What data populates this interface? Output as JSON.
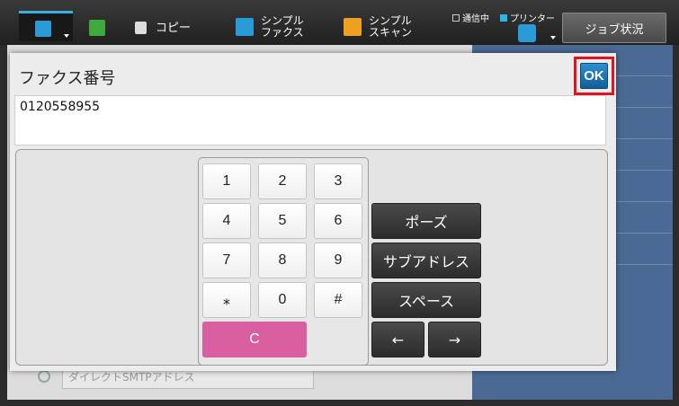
{
  "topbar": {
    "copy_label": "コピー",
    "simple_fax_label_1": "シンプル",
    "simple_fax_label_2": "ファクス",
    "simple_scan_label_1": "シンプル",
    "simple_scan_label_2": "スキャン",
    "status_comm": "通信中",
    "status_printer": "プリンター",
    "job_status_label": "ジョブ状況"
  },
  "background": {
    "bottom_field_text": "ダイレクトSMTPアドレス"
  },
  "dialog": {
    "title": "ファクス番号",
    "ok_label": "OK",
    "number_value": "0120558955"
  },
  "keypad": {
    "keys": [
      "1",
      "2",
      "3",
      "4",
      "5",
      "6",
      "7",
      "8",
      "9",
      "⁎",
      "0",
      "#"
    ],
    "clear_label": "C"
  },
  "function_keys": {
    "pause": "ポーズ",
    "subaddress": "サブアドレス",
    "space": "スペース",
    "left": "←",
    "right": "→"
  },
  "colors": {
    "accent_blue": "#2a9bd6",
    "ok_highlight": "#e0141e",
    "clear_pink": "#d95fa2"
  }
}
